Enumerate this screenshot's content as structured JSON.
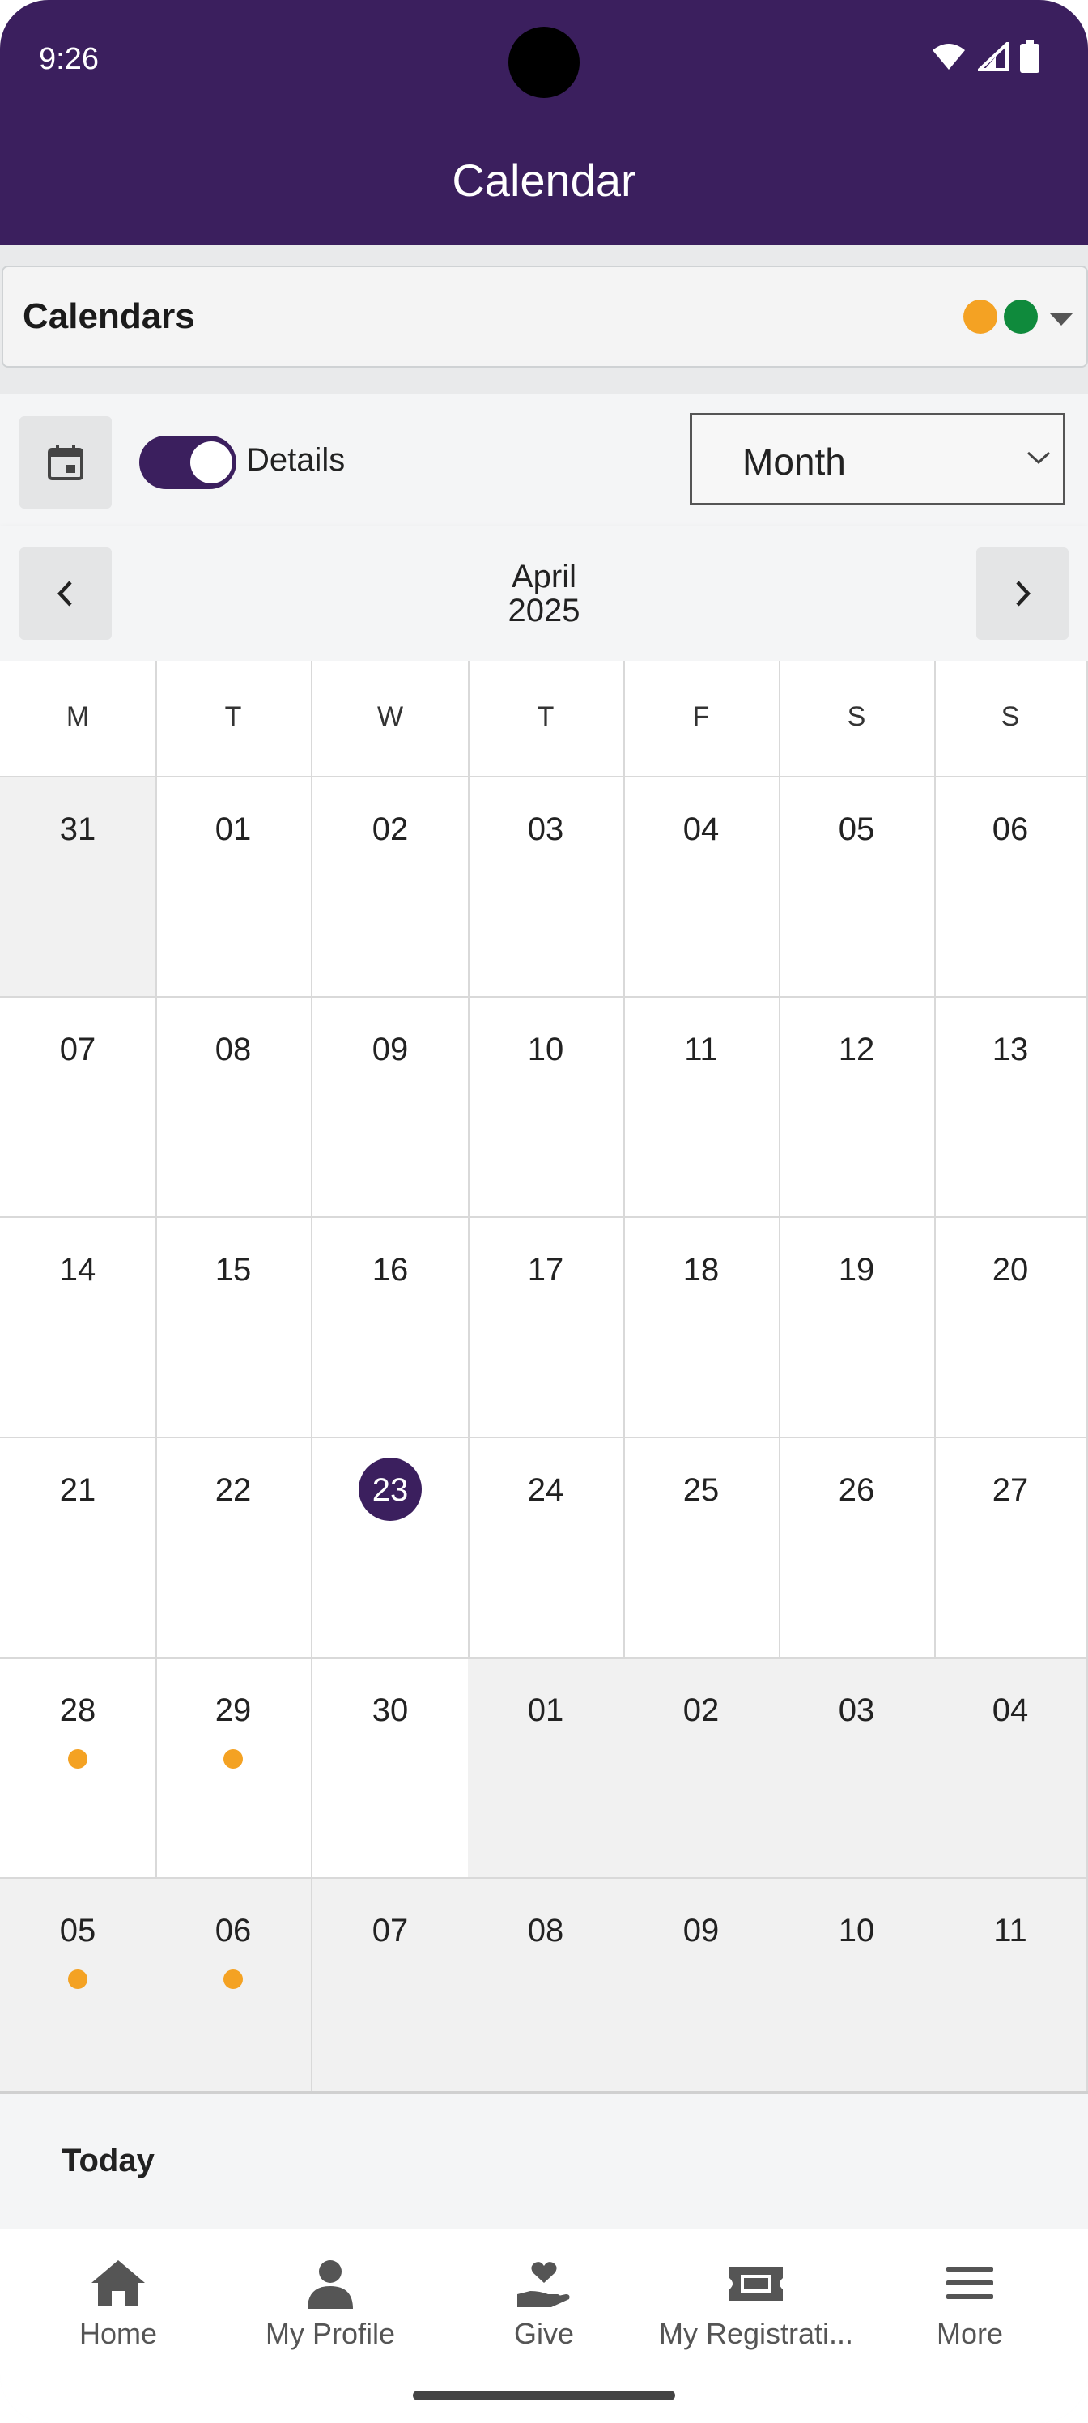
{
  "status_bar": {
    "time": "9:26"
  },
  "header": {
    "title": "Calendar"
  },
  "calendars": {
    "label": "Calendars",
    "colors": [
      "#f4a223",
      "#0f8a3c"
    ]
  },
  "toolbar": {
    "details_label": "Details",
    "details_on": true,
    "view_select": "Month"
  },
  "month_nav": {
    "month": "April",
    "year": "2025"
  },
  "weekdays": [
    "M",
    "T",
    "W",
    "T",
    "F",
    "S",
    "S"
  ],
  "weeks": [
    [
      {
        "d": "31",
        "other": true
      },
      {
        "d": "01"
      },
      {
        "d": "02"
      },
      {
        "d": "03"
      },
      {
        "d": "04"
      },
      {
        "d": "05"
      },
      {
        "d": "06"
      }
    ],
    [
      {
        "d": "07"
      },
      {
        "d": "08"
      },
      {
        "d": "09"
      },
      {
        "d": "10"
      },
      {
        "d": "11"
      },
      {
        "d": "12"
      },
      {
        "d": "13"
      }
    ],
    [
      {
        "d": "14"
      },
      {
        "d": "15"
      },
      {
        "d": "16"
      },
      {
        "d": "17"
      },
      {
        "d": "18"
      },
      {
        "d": "19"
      },
      {
        "d": "20"
      }
    ],
    [
      {
        "d": "21"
      },
      {
        "d": "22"
      },
      {
        "d": "23",
        "today": true
      },
      {
        "d": "24"
      },
      {
        "d": "25"
      },
      {
        "d": "26"
      },
      {
        "d": "27"
      }
    ],
    [
      {
        "d": "28",
        "event": true
      },
      {
        "d": "29",
        "event": true
      },
      {
        "d": "30"
      },
      {
        "d": "01",
        "other": true
      },
      {
        "d": "02",
        "other": true
      },
      {
        "d": "03",
        "other": true
      },
      {
        "d": "04",
        "other": true
      }
    ],
    [
      {
        "d": "05",
        "other": true,
        "event": true
      },
      {
        "d": "06",
        "other": true,
        "event": true
      },
      {
        "d": "07",
        "other": true
      },
      {
        "d": "08",
        "other": true
      },
      {
        "d": "09",
        "other": true
      },
      {
        "d": "10",
        "other": true
      },
      {
        "d": "11",
        "other": true
      }
    ]
  ],
  "today_section": {
    "label": "Today"
  },
  "bottom_nav": [
    {
      "label": "Home",
      "icon": "home-icon"
    },
    {
      "label": "My Profile",
      "icon": "person-icon"
    },
    {
      "label": "Give",
      "icon": "give-icon"
    },
    {
      "label": "My Registrati...",
      "icon": "ticket-icon"
    },
    {
      "label": "More",
      "icon": "menu-icon"
    }
  ],
  "colors": {
    "brand": "#3b1f5e",
    "event_dot": "#f4a223"
  }
}
